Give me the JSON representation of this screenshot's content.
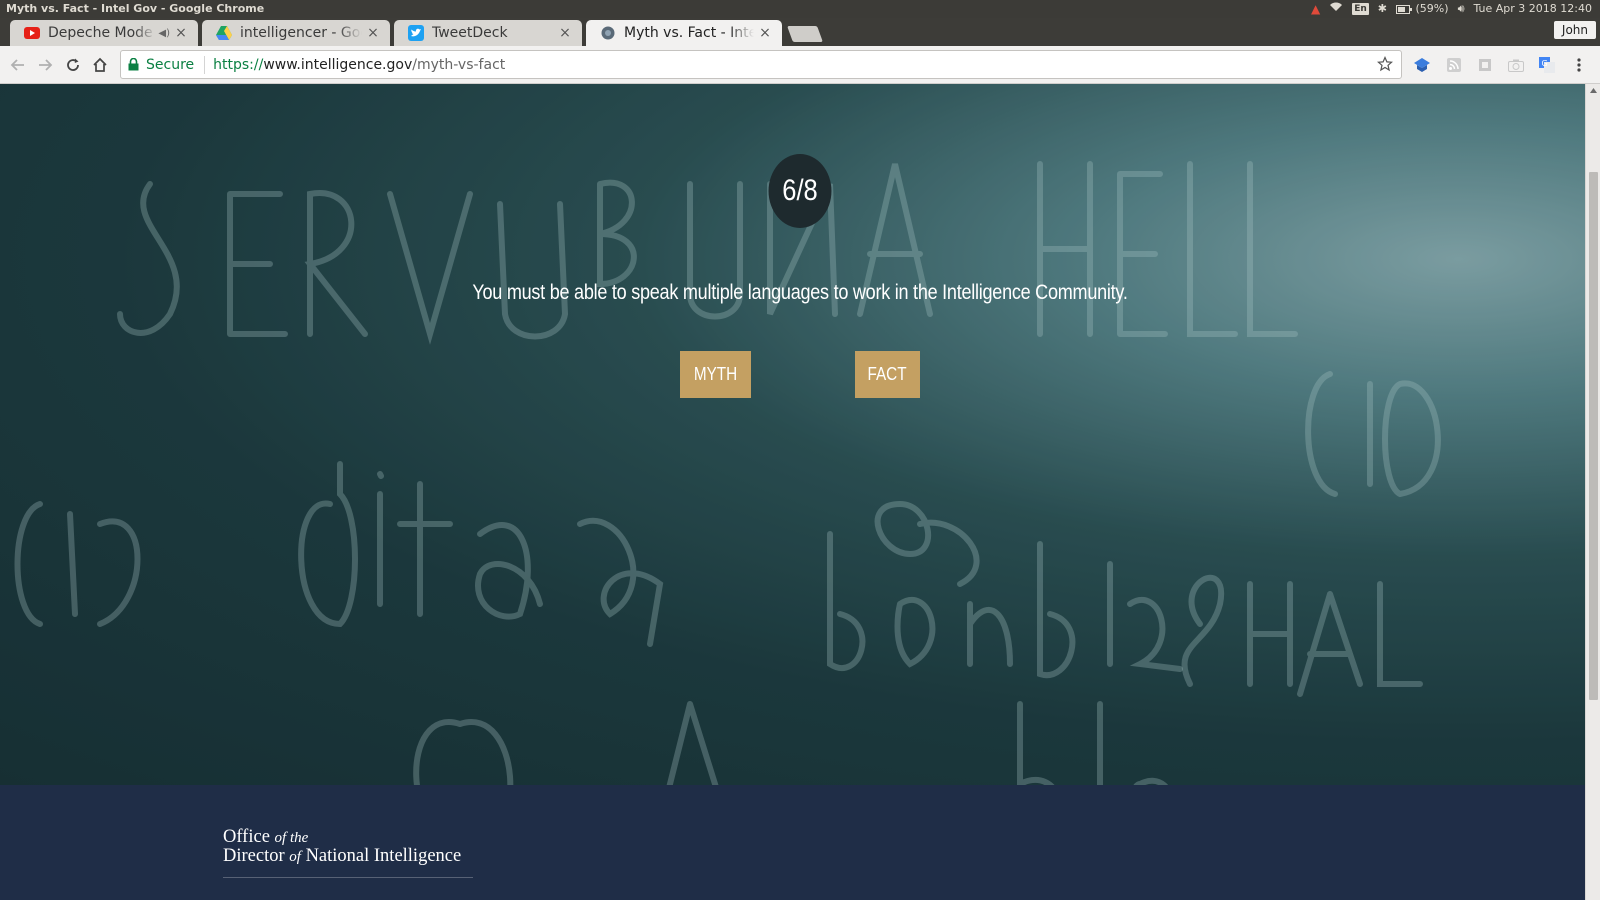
{
  "os": {
    "window_title": "Myth vs. Fact - Intel Gov - Google Chrome",
    "battery": "(59%)",
    "keyboard": "En",
    "clock": "Tue Apr  3 2018 12:40"
  },
  "browser": {
    "profile_name": "John",
    "tabs": [
      {
        "title": "Depeche Mode - ",
        "favicon": "youtube-icon"
      },
      {
        "title": "intelligencer - Goog",
        "favicon": "google-drive-icon"
      },
      {
        "title": "TweetDeck",
        "favicon": "twitter-icon"
      },
      {
        "title": "Myth vs. Fact - Intel",
        "favicon": "globe-icon"
      }
    ],
    "omnibox": {
      "security_label": "Secure",
      "scheme": "https://",
      "host": "www.intelligence.gov",
      "path": "/myth-vs-fact"
    }
  },
  "quiz": {
    "counter": "6/8",
    "statement": "You must be able to speak multiple languages to work in the Intelligence Community.",
    "myth_label": "MYTH",
    "fact_label": "FACT"
  },
  "footer": {
    "logo_line1_a": "Office ",
    "logo_line1_b": "of the",
    "logo_line2_a": "Director ",
    "logo_line2_b": "of",
    "logo_line2_c": " National Intelligence"
  },
  "colors": {
    "button_gold": "#c4a062",
    "footer_navy": "#1f2d47",
    "counter_bg": "#1e2a2e",
    "secure_green": "#0b8043"
  }
}
